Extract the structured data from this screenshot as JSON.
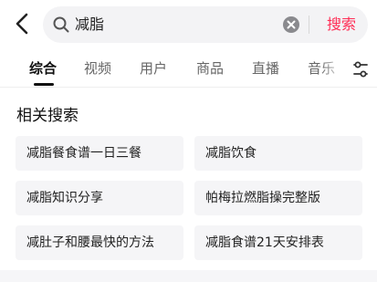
{
  "search": {
    "query": "减脂",
    "submit_label": "搜索",
    "back_icon": "chevron-left-icon",
    "search_icon": "search-icon",
    "clear_icon": "clear-circle-icon"
  },
  "tabs": [
    {
      "label": "综合",
      "active": true
    },
    {
      "label": "视频",
      "active": false
    },
    {
      "label": "用户",
      "active": false
    },
    {
      "label": "商品",
      "active": false
    },
    {
      "label": "直播",
      "active": false
    },
    {
      "label": "音乐",
      "active": false
    }
  ],
  "filter_icon": "filter-icon",
  "related": {
    "title": "相关搜索",
    "items": [
      "减脂餐食谱一日三餐",
      "减脂饮食",
      "减脂知识分享",
      "帕梅拉燃脂操完整版",
      "减肚子和腰最快的方法",
      "减脂食谱21天安排表"
    ]
  },
  "colors": {
    "accent": "#ff2d55",
    "search_bg": "#f3f3f5",
    "chip_bg": "#f5f5f7"
  }
}
